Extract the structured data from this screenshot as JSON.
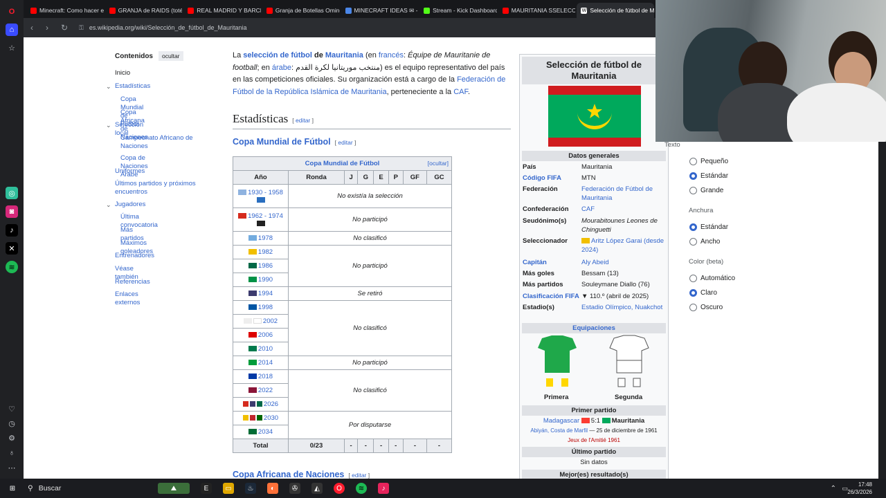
{
  "tabs": [
    "Minecraft: Como hacer el",
    "GRANJA de RAIDS (totém",
    "REAL MADRID Y BARCELO",
    "Granja de Botellas Omino",
    "MINECRAFT IDEAS ✉ - G",
    "Stream - Kick Dashboard",
    "MAURITANIA SSELECCION",
    "Selección de fútbol de M"
  ],
  "url": "es.wikipedia.org/wiki/Selección_de_fútbol_de_Mauritania",
  "toc": {
    "title": "Contenidos",
    "hide": "ocultar",
    "items": [
      "Inicio",
      "Estadísticas",
      "Copa Mundial de Fútbol",
      "Copa Africana de Naciones",
      "Selección local",
      "Campeonato Africano de Naciones",
      "Copa de Naciones Árabe",
      "Uniformes",
      "Últimos partidos y próximos encuentros",
      "Jugadores",
      "Última convocatoria",
      "Más partidos",
      "Máximos goleadores",
      "Entrenadores",
      "Véase también",
      "Referencias",
      "Enlaces externos"
    ]
  },
  "intro": {
    "t1": "La ",
    "l1": "selección de fútbol",
    "t2": " de ",
    "l2": "Mauritania",
    "t3": " (en ",
    "l3": "francés",
    "t4": ": ",
    "i1": "Équipe de Mauritanie de football",
    "t5": "; en ",
    "l4": "árabe",
    "t6": ": منتخب موريتانيا لكرة القدم",
    "t7": ") es el equipo representativo del país en las competiciones oficiales. Su organización está a cargo de la ",
    "l5": "Federación de Fútbol de la República Islámica de Mauritania",
    "t8": ", perteneciente a la ",
    "l6": "CAF",
    "t9": "."
  },
  "h_estadisticas": "Estadísticas",
  "edit": "editar",
  "h_copa_mundial": "Copa Mundial de Fútbol",
  "h_copa_africana": "Copa Africana de Naciones",
  "wc": {
    "caption": "Copa Mundial de Fútbol",
    "hide": "[ocultar]",
    "headers": [
      "Año",
      "Ronda",
      "J",
      "G",
      "E",
      "P",
      "GF",
      "GC"
    ],
    "years": [
      "1930 - 1958",
      "1962 - 1974",
      "1978",
      "1982",
      "1986",
      "1990",
      "1994",
      "1998",
      "2002",
      "2006",
      "2010",
      "2014",
      "2018",
      "2022",
      "2026",
      "2030",
      "2034"
    ],
    "r1": "No existía la selección",
    "r2": "No participó",
    "r3": "No clasificó",
    "r4": "No participó",
    "r5": "Se retiró",
    "r6": "No clasificó",
    "r7": "No participó",
    "r8": "No clasificó",
    "r9": "Por disputarse",
    "total": [
      "Total",
      "0/23",
      "-",
      "-",
      "-",
      "-",
      "-",
      "-"
    ]
  },
  "infobox": {
    "title": "Selección de fútbol de Mauritania",
    "general": "Datos generales",
    "rows": [
      [
        "País",
        "Mauritania"
      ],
      [
        "Código FIFA",
        "MTN"
      ],
      [
        "Federación",
        "Federación de Fútbol de Mauritania"
      ],
      [
        "Confederación",
        "CAF"
      ],
      [
        "Seudónimo(s)",
        "Mourabitounes Leones de Chinguetti"
      ],
      [
        "Seleccionador",
        "Aritz López Garai (desde 2024)"
      ],
      [
        "Capitán",
        "Aly Abeid"
      ],
      [
        "Más goles",
        "Bessam (13)"
      ],
      [
        "Más partidos",
        "Souleymane Diallo (76)"
      ],
      [
        "Clasificación FIFA",
        "▼ 110.º (abril de 2025)"
      ],
      [
        "Estadio(s)",
        "Estadio Olímpico, Nuakchot"
      ]
    ],
    "equip": "Equipaciones",
    "kit1": "Primera",
    "kit2": "Segunda",
    "first": "Primer partido",
    "first_a": "Madagascar",
    "first_s": "5:1",
    "first_b": "Mauritania",
    "first_loc": "Abiyán, Costa de Marfil",
    "first_date": "— 25 de diciembre de 1961",
    "first_comp": "Jeux de l'Amitié 1961",
    "last": "Último partido",
    "last_v": "Sin datos",
    "best": "Mejor(es) resultado(s)"
  },
  "panel": {
    "texto": "Texto",
    "t_opts": [
      "Pequeño",
      "Estándar",
      "Grande"
    ],
    "anchura": "Anchura",
    "a_opts": [
      "Estándar",
      "Ancho"
    ],
    "color": "Color (beta)",
    "c_opts": [
      "Automático",
      "Claro",
      "Oscuro"
    ]
  },
  "taskbar": {
    "search": "Buscar",
    "time": "17:48",
    "date": "26/3/2026"
  },
  "colors": {
    "link": "#3366cc",
    "flag_green": "#00a95c",
    "flag_red": "#d01c1f",
    "flag_yellow": "#ffd700"
  }
}
